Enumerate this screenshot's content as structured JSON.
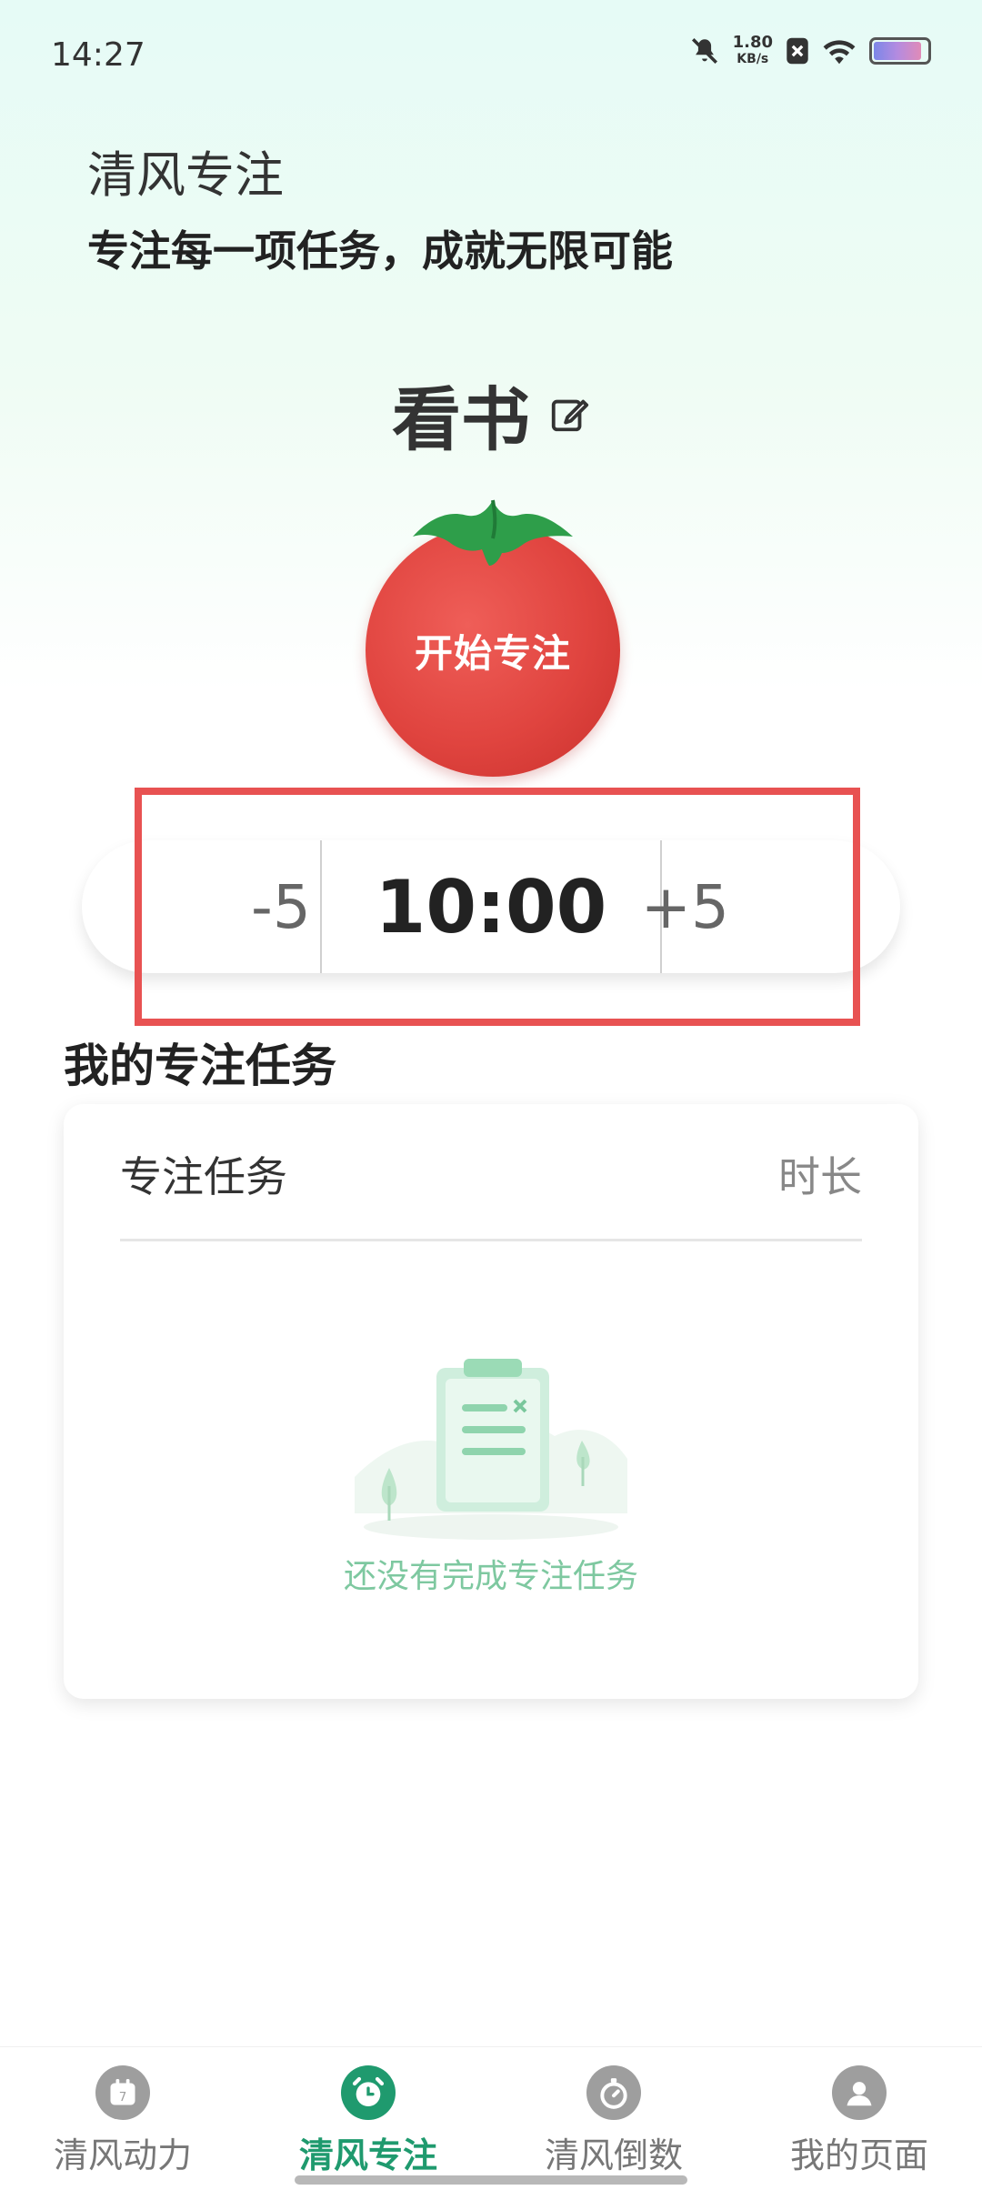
{
  "status_bar": {
    "time": "14:27",
    "net_speed_value": "1.80",
    "net_speed_unit": "KB/s",
    "battery_level": 0.9,
    "icons": [
      "mute-icon",
      "net-speed",
      "sim-off-icon",
      "wifi-icon",
      "battery-icon"
    ]
  },
  "header": {
    "title": "清风专注",
    "subtitle": "专注每一项任务，成就无限可能"
  },
  "task": {
    "name": "看书",
    "edit_icon": "edit-icon"
  },
  "start_button": {
    "label": "开始专注"
  },
  "timer": {
    "minus_label": "-5",
    "time": "10:00",
    "plus_label": "+5"
  },
  "my_tasks": {
    "section_title": "我的专注任务",
    "column_task": "专注任务",
    "column_duration": "时长",
    "empty_text": "还没有完成专注任务"
  },
  "bottom_nav": {
    "items": [
      {
        "label": "清风动力",
        "icon": "calendar-icon",
        "active": false
      },
      {
        "label": "清风专注",
        "icon": "clock-icon",
        "active": true
      },
      {
        "label": "清风倒数",
        "icon": "stopwatch-icon",
        "active": false
      },
      {
        "label": "我的页面",
        "icon": "user-icon",
        "active": false
      }
    ]
  },
  "colors": {
    "accent": "#1f9a6e",
    "tomato": "#e0443f",
    "highlight": "#e85252",
    "empty_text": "#7ec8a0"
  }
}
